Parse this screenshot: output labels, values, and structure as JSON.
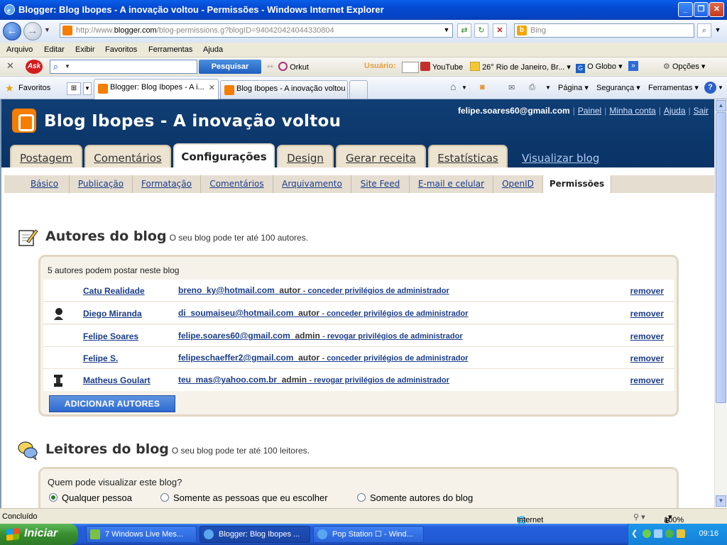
{
  "window": {
    "title": "Blogger: Blog Ibopes - A inovação voltou - Permissões - Windows Internet Explorer"
  },
  "address": {
    "url_prefix": "http://www.",
    "url_host": "blogger.com",
    "url_rest": "/blog-permissions.g?blogID=940420424044330804",
    "search_placeholder": "Bing"
  },
  "menu": [
    "Arquivo",
    "Editar",
    "Exibir",
    "Favoritos",
    "Ferramentas",
    "Ajuda"
  ],
  "ask_toolbar": {
    "button": "Pesquisar",
    "orkut": "Orkut",
    "usuario": "Usuário:",
    "youtube": "YouTube",
    "weather": "26° Rio de Janeiro, Br...",
    "globo": "O Globo",
    "options": "Opções"
  },
  "tabs_bar": {
    "favorites": "Favoritos",
    "tab1": "Blogger: Blog Ibopes - A i...",
    "tab2": "Blog Ibopes - A inovação voltou",
    "pagina": "Página",
    "seguranca": "Segurança",
    "ferramentas": "Ferramentas"
  },
  "blogger": {
    "blog_name": "Blog Ibopes - A inovação voltou",
    "user_email": "felipe.soares60@gmail.com",
    "links": [
      "Painel",
      "Minha conta",
      "Ajuda",
      "Sair"
    ],
    "main_tabs": [
      "Postagem",
      "Comentários",
      "Configurações",
      "Design",
      "Gerar receita",
      "Estatísticas"
    ],
    "view_blog": "Visualizar blog",
    "sub_tabs": [
      "Básico",
      "Publicação",
      "Formatação",
      "Comentários",
      "Arquivamento",
      "Site Feed",
      "E-mail e celular",
      "OpenID",
      "Permissões"
    ]
  },
  "authors": {
    "title": "Autores do blog",
    "subtitle": "O seu blog pode ter até 100 autores.",
    "caption": "5 autores podem postar neste blog",
    "rows": [
      {
        "name": "Catu Realidade",
        "email": "breno_ky@hotmail.com",
        "role": "autor",
        "admin_action": "conceder privilégios de administrador",
        "remove": "remover"
      },
      {
        "name": "Diego Miranda",
        "email": "di_soumaiseu@hotmail.com",
        "role": "autor",
        "admin_action": "conceder privilégios de administrador",
        "remove": "remover"
      },
      {
        "name": "Felipe Soares",
        "email": "felipe.soares60@gmail.com",
        "role": "admin",
        "admin_action": "revogar privilégios de administrador",
        "remove": "remover"
      },
      {
        "name": "Felipe S.",
        "email": "felipeschaeffer2@gmail.com",
        "role": "autor",
        "admin_action": "conceder privilégios de administrador",
        "remove": "remover"
      },
      {
        "name": "Matheus Goulart",
        "email": "teu_mas@yahoo.com.br",
        "role": "admin",
        "admin_action": "revogar privilégios de administrador",
        "remove": "remover"
      }
    ],
    "add_button": "ADICIONAR AUTORES"
  },
  "readers": {
    "title": "Leitores do blog",
    "subtitle": "O seu blog pode ter até 100 leitores.",
    "question": "Quem pode visualizar este blog?",
    "options": [
      "Qualquer pessoa",
      "Somente as pessoas que eu escolher",
      "Somente autores do blog"
    ],
    "selected": "Qualquer pessoa"
  },
  "status": {
    "text": "Concluído",
    "zone": "Internet",
    "zoom": "100%"
  },
  "taskbar": {
    "start": "Iniciar",
    "tasks": [
      "7 Windows Live Mes...",
      "Blogger: Blog Ibopes ...",
      "Pop Station ☐ - Wind..."
    ],
    "clock": "09:16"
  },
  "colors": {
    "blogger_orange": "#f57d00",
    "header_navy": "#0a3366",
    "link_blue": "#1a3c8a"
  }
}
